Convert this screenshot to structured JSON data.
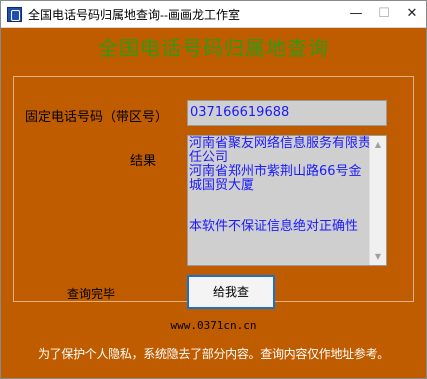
{
  "window": {
    "title": "全国电话号码归属地查询--画画龙工作室",
    "controls": {
      "minimize": "—",
      "maximize": "☐",
      "close": "✕"
    },
    "app_icon": "phone-app-icon"
  },
  "main": {
    "headline": "全国电话号码归属地查询",
    "phone_label": "固定电话号码（带区号）",
    "phone_value": "037166619688",
    "result_label": "结果",
    "result_lines": [
      "河南省聚友网络信息服务有限责任公司",
      "河南省郑州市紫荆山路66号金城国贸大厦",
      "本软件不保证信息绝对正确性"
    ],
    "status_text": "查询完毕",
    "query_button": "给我查",
    "website": "www.0371cn.cn",
    "privacy_notice": "为了保护个人隐私，系统隐去了部分内容。查询内容仅作地址参考。"
  },
  "colors": {
    "background": "#c05c00",
    "headline": "#2f9a12",
    "result_text": "#1a1aff",
    "notice_text": "#ffffff"
  }
}
